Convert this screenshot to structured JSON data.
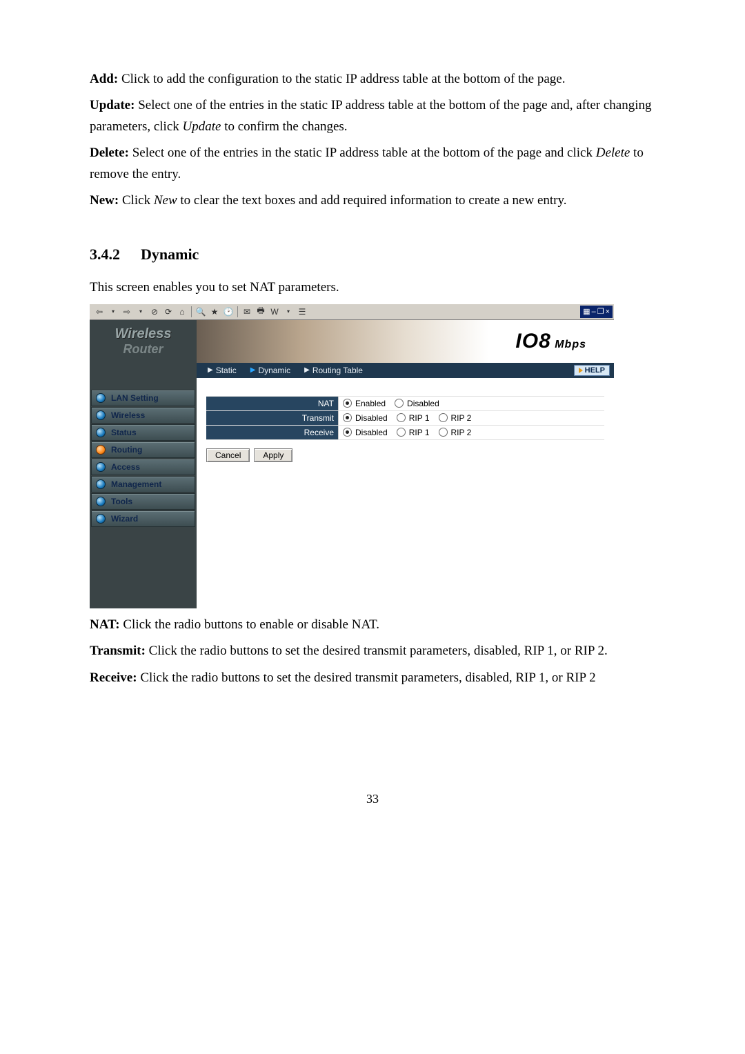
{
  "intro": {
    "add_label": "Add:",
    "add_text": " Click to add the configuration to the static IP address table at the bottom of the page.",
    "update_label": "Update:",
    "update_text_a": " Select one of the entries in the static IP address table at the bottom of the page and, after changing parameters, click ",
    "update_em": "Update",
    "update_text_b": " to confirm the changes.",
    "delete_label": "Delete:",
    "delete_text_a": " Select one of the entries in the static IP address table at the bottom of the page and click ",
    "delete_em": "Delete",
    "delete_text_b": " to remove the entry.",
    "new_label": "New:",
    "new_text_a": " Click ",
    "new_em": "New",
    "new_text_b": " to clear the text boxes and add required information to create a new entry."
  },
  "section": {
    "number": "3.4.2",
    "title": "Dynamic",
    "lead": "This screen enables you to set NAT parameters."
  },
  "screenshot": {
    "window_controls": {
      "minimize": "–",
      "restore": "❐",
      "close": "×",
      "prefix_icon": "▦"
    },
    "logo": {
      "line1": "Wireless",
      "line2": "Router"
    },
    "banner": {
      "main": "IO8",
      "suffix": " Mbps"
    },
    "tabs": {
      "static": "Static",
      "dynamic": "Dynamic",
      "routing_table": "Routing Table"
    },
    "help": "HELP",
    "nav": {
      "lan": "LAN Setting",
      "wireless": "Wireless",
      "status": "Status",
      "routing": "Routing",
      "access": "Access",
      "management": "Management",
      "tools": "Tools",
      "wizard": "Wizard"
    },
    "form": {
      "nat_label": "NAT",
      "nat_enabled": "Enabled",
      "nat_disabled": "Disabled",
      "transmit_label": "Transmit",
      "receive_label": "Receive",
      "opt_disabled": "Disabled",
      "opt_rip1": "RIP 1",
      "opt_rip2": "RIP 2",
      "cancel": "Cancel",
      "apply": "Apply"
    }
  },
  "desc": {
    "nat_label": "NAT:",
    "nat_text": " Click the radio buttons to enable or disable NAT.",
    "transmit_label": "Transmit:",
    "transmit_text": " Click the radio buttons to set the desired transmit parameters, disabled, RIP 1, or RIP 2.",
    "receive_label": "Receive:",
    "receive_text": " Click the radio buttons to set the desired transmit parameters, disabled, RIP 1, or RIP 2"
  },
  "page_number": "33"
}
